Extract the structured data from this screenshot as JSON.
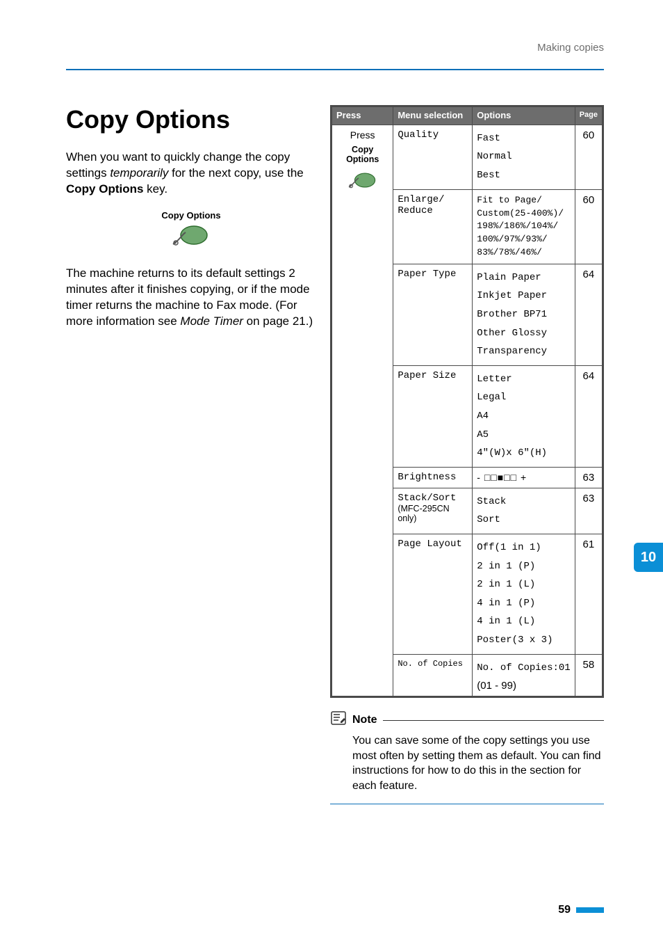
{
  "crumb": "Making copies",
  "heading": "Copy Options",
  "para1_a": "When you want to quickly change the copy settings ",
  "para1_ital": "temporarily",
  "para1_b": " for the next copy, use the ",
  "para1_bold": "Copy Options",
  "para1_c": " key.",
  "btn_label": "Copy Options",
  "para2_a": "The machine returns to its default settings 2 minutes after it finishes copying, or if the mode timer returns the machine to Fax mode. (For more information see ",
  "para2_ital": "Mode Timer",
  "para2_b": " on page 21.)",
  "table": {
    "headers": {
      "press": "Press",
      "menu": "Menu selection",
      "options": "Options",
      "page": "Page"
    },
    "press_cell": {
      "line1": "Press",
      "line2": "Copy Options"
    },
    "rows": [
      {
        "menu": "Quality",
        "menu_sub": "",
        "options_lines": [
          "Fast",
          "Normal",
          "Best"
        ],
        "page": "60"
      },
      {
        "menu": "Enlarge/\nReduce",
        "menu_sub": "",
        "options_block": "Fit to Page/\nCustom(25-400%)/\n198%/186%/104%/\n100%/97%/93%/\n83%/78%/46%/",
        "page": "60"
      },
      {
        "menu": "Paper Type",
        "menu_sub": "",
        "options_lines": [
          "Plain Paper",
          "Inkjet Paper",
          "Brother BP71",
          "Other Glossy",
          "Transparency"
        ],
        "page": "64"
      },
      {
        "menu": "Paper Size",
        "menu_sub": "",
        "options_lines": [
          "Letter",
          "Legal",
          "A4",
          "A5",
          "4\"(W)x 6\"(H)"
        ],
        "page": "64"
      },
      {
        "menu": "Brightness",
        "menu_sub": "",
        "options_brightness": true,
        "page": "63"
      },
      {
        "menu": "Stack/Sort",
        "menu_sub": "(MFC-295CN only)",
        "options_lines": [
          "Stack",
          "Sort"
        ],
        "page": "63"
      },
      {
        "menu": "Page Layout",
        "menu_sub": "",
        "options_lines": [
          "Off(1 in 1)",
          "2 in 1 (P)",
          "2 in 1 (L)",
          "4 in 1 (P)",
          "4 in 1 (L)",
          "Poster(3 x 3)"
        ],
        "page": "61"
      },
      {
        "menu": "No. of Copies",
        "menu_sub": "",
        "options_lines": [
          "No. of Copies:01"
        ],
        "options_extra": "(01 - 99)",
        "page": "58"
      }
    ]
  },
  "note": {
    "label": "Note",
    "body": "You can save some of the copy settings you use most often by setting them as default. You can find instructions for how to do this in the section for each feature."
  },
  "side_tab": "10",
  "page_num": "59"
}
